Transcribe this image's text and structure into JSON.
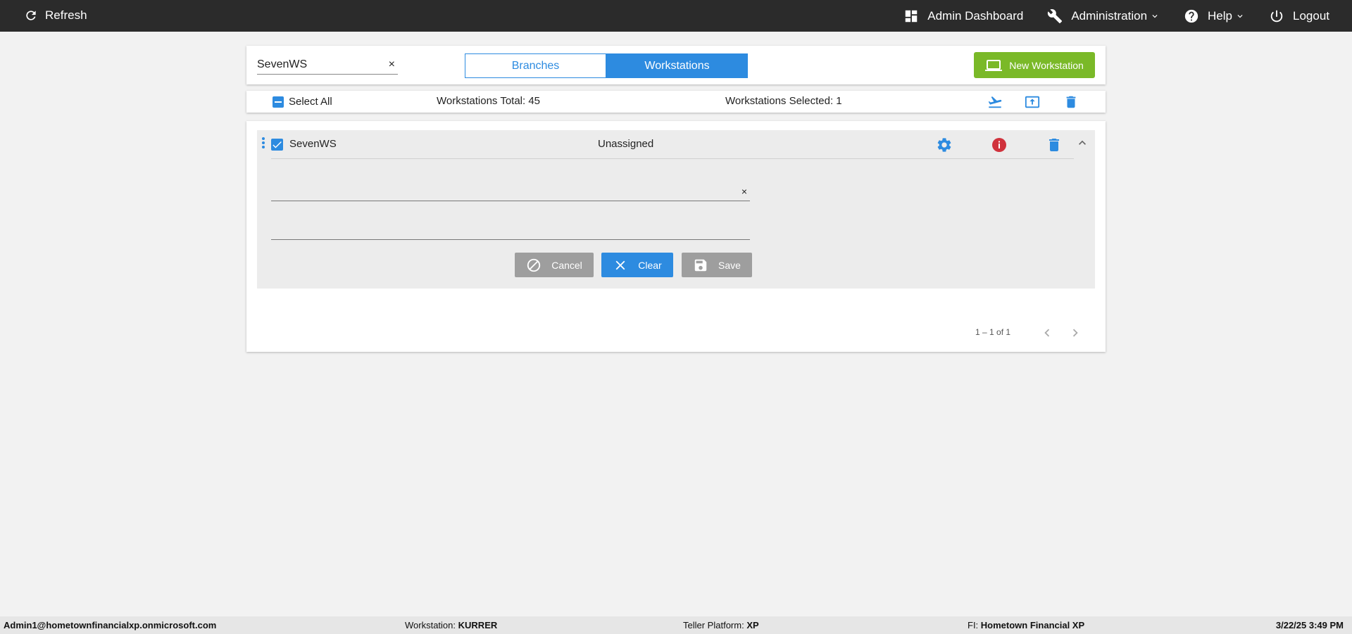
{
  "topbar": {
    "refresh_label": "Refresh",
    "admin_dashboard_label": "Admin Dashboard",
    "administration_label": "Administration",
    "help_label": "Help",
    "logout_label": "Logout"
  },
  "search": {
    "value": "SevenWS",
    "clear_glyph": "×"
  },
  "tabs": {
    "branches": "Branches",
    "workstations": "Workstations"
  },
  "new_workstation_label": "New Workstation",
  "selection": {
    "select_all_label": "Select All",
    "total_label": "Workstations Total: 45",
    "selected_label": "Workstations Selected: 1"
  },
  "row": {
    "name": "SevenWS",
    "status": "Unassigned",
    "field1_value": "",
    "field1_clear_glyph": "×",
    "field2_value": ""
  },
  "actions": {
    "cancel": "Cancel",
    "clear": "Clear",
    "save": "Save"
  },
  "pager": {
    "range": "1 – 1 of 1"
  },
  "statusbar": {
    "user": "Admin1@hometownfinancialxp.onmicrosoft.com",
    "workstation_label": "Workstation:",
    "workstation_value": "KURRER",
    "platform_label": "Teller Platform:",
    "platform_value": "XP",
    "fi_label": "FI:",
    "fi_value": "Hometown Financial XP",
    "datetime": "3/22/25 3:49 PM"
  },
  "colors": {
    "accent": "#2d8be0",
    "success": "#7ab928",
    "danger": "#d0323c",
    "topbar": "#2b2b2b",
    "disabled": "#9e9e9e"
  }
}
